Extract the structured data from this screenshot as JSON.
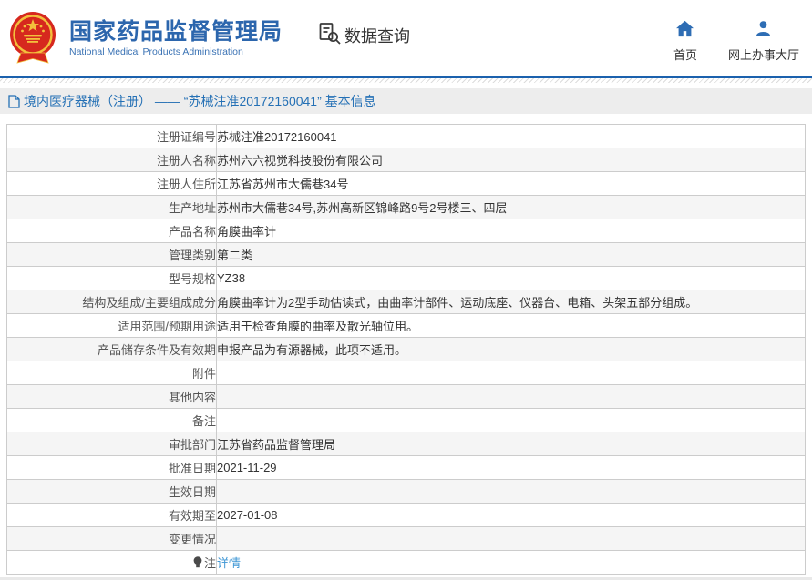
{
  "header": {
    "org_name": "国家药品监督管理局",
    "org_name_en": "National Medical Products Administration",
    "section_title": "数据查询",
    "nav": {
      "home_label": "首页",
      "hall_label": "网上办事大厅"
    }
  },
  "breadcrumb": {
    "text": "境内医疗器械（注册） ——  “苏械注准20172160041” 基本信息"
  },
  "table": {
    "rows": [
      {
        "label": "注册证编号",
        "value": "苏械注准20172160041"
      },
      {
        "label": "注册人名称",
        "value": "苏州六六视觉科技股份有限公司"
      },
      {
        "label": "注册人住所",
        "value": "江苏省苏州市大儒巷34号"
      },
      {
        "label": "生产地址",
        "value": "苏州市大儒巷34号,苏州高新区锦峰路9号2号楼三、四层"
      },
      {
        "label": "产品名称",
        "value": "角膜曲率计"
      },
      {
        "label": "管理类别",
        "value": "第二类"
      },
      {
        "label": "型号规格",
        "value": "YZ38"
      },
      {
        "label": "结构及组成/主要组成成分",
        "value": "角膜曲率计为2型手动估读式，由曲率计部件、运动底座、仪器台、电箱、头架五部分组成。"
      },
      {
        "label": "适用范围/预期用途",
        "value": "适用于检查角膜的曲率及散光轴位用。"
      },
      {
        "label": "产品储存条件及有效期",
        "value": "申报产品为有源器械，此项不适用。"
      },
      {
        "label": "附件",
        "value": ""
      },
      {
        "label": "其他内容",
        "value": ""
      },
      {
        "label": "备注",
        "value": ""
      },
      {
        "label": "审批部门",
        "value": "江苏省药品监督管理局"
      },
      {
        "label": "批准日期",
        "value": "2021-11-29"
      },
      {
        "label": "生效日期",
        "value": ""
      },
      {
        "label": "有效期至",
        "value": "2027-01-08"
      },
      {
        "label": "变更情况",
        "value": ""
      },
      {
        "label": "注",
        "value": "详情",
        "link": true,
        "icon": "bulb-icon"
      }
    ]
  },
  "colors": {
    "brand_blue": "#2c66ad",
    "line_blue": "#1b61ad",
    "breadcrumb_blue": "#2470b5",
    "link_blue": "#3f97d5",
    "emblem_red": "#d6281e",
    "emblem_gold": "#f3c03c",
    "row_alt_bg": "#f5f5f5",
    "table_border": "#cccccc"
  }
}
